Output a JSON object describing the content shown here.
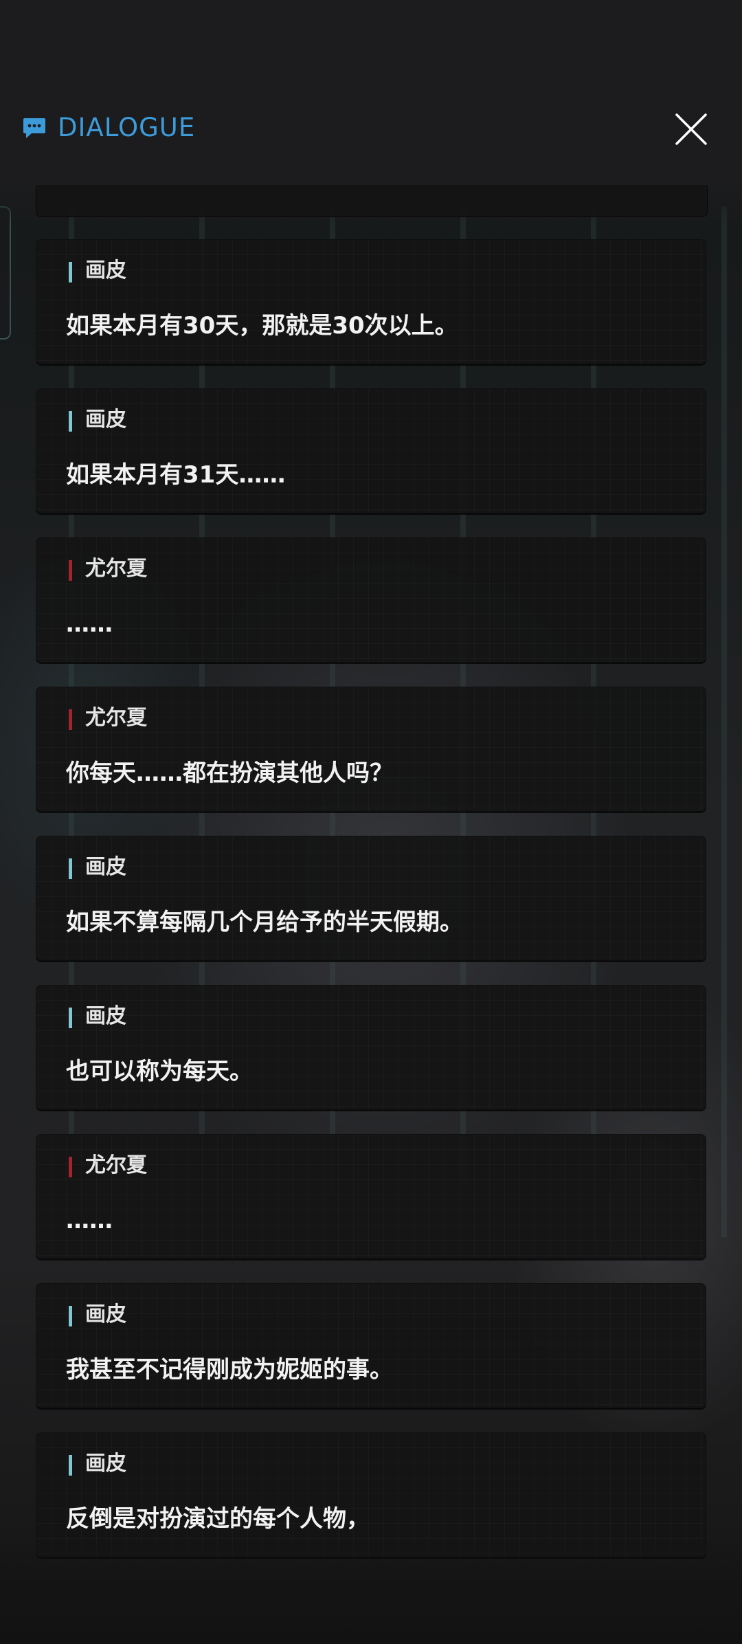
{
  "header": {
    "title": "DIALOGUE",
    "icon": "chat-bubble-icon",
    "close_icon": "close-icon",
    "accent": "#3d9bd9"
  },
  "speaker_colors": {
    "画皮": "#7fc8d3",
    "尤尔夏": "#a3232f"
  },
  "dialogue": [
    {
      "speaker": "画皮",
      "text": "如果本月有30天，那就是30次以上。"
    },
    {
      "speaker": "画皮",
      "text": "如果本月有31天……"
    },
    {
      "speaker": "尤尔夏",
      "text": "……"
    },
    {
      "speaker": "尤尔夏",
      "text": "你每天……都在扮演其他人吗？"
    },
    {
      "speaker": "画皮",
      "text": "如果不算每隔几个月给予的半天假期。"
    },
    {
      "speaker": "画皮",
      "text": "也可以称为每天。"
    },
    {
      "speaker": "尤尔夏",
      "text": "……"
    },
    {
      "speaker": "画皮",
      "text": "我甚至不记得刚成为妮姬的事。"
    },
    {
      "speaker": "画皮",
      "text": "反倒是对扮演过的每个人物，"
    }
  ]
}
